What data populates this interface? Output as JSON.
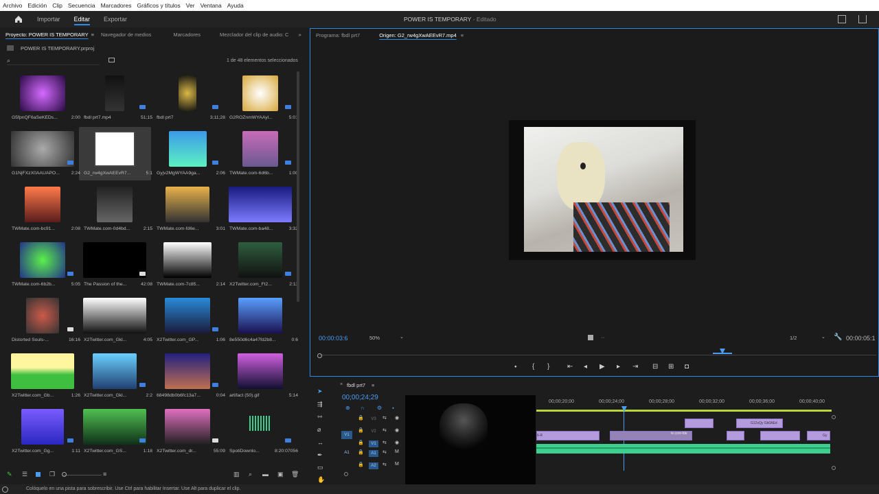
{
  "menu": [
    "Archivo",
    "Edición",
    "Clip",
    "Secuencia",
    "Marcadores",
    "Gráficos y títulos",
    "Ver",
    "Ventana",
    "Ayuda"
  ],
  "workspaces": {
    "import": "Importar",
    "edit": "Editar",
    "export": "Exportar"
  },
  "doc": {
    "title": "POWER IS TEMPORARY",
    "state": "- Editado"
  },
  "project_tabs": [
    "Proyecto: POWER IS TEMPORARY",
    "Navegador de medios",
    "Marcadores",
    "Mezclador del clip de audio: C"
  ],
  "project_file": "POWER IS TEMPORARY.prproj",
  "selection_count": "1 de 48 elementos seleccionados",
  "items": [
    {
      "name": "G5fpnQF6aSeKEDs...",
      "dur": "2:00"
    },
    {
      "name": "fbdl prt7.mp4",
      "dur": "51;15"
    },
    {
      "name": "fbdl prt7",
      "dur": "3;11;28"
    },
    {
      "name": "G2ROZnmWYAAyl...",
      "dur": "5:01"
    },
    {
      "name": "G1NjFXzX0AAUAPO...",
      "dur": "2:24"
    },
    {
      "name": "G2_rw4gXwAEEvR7...",
      "dur": "5:1"
    },
    {
      "name": "Gyjv2MgWYAA9ga...",
      "dur": "2:06"
    },
    {
      "name": "TWMate.com-6d6b...",
      "dur": "1:00"
    },
    {
      "name": "TWMate.com-bc91...",
      "dur": "2:08"
    },
    {
      "name": "TWMate.com-0d4bd...",
      "dur": "2:15"
    },
    {
      "name": "TWMate.com-fd6e...",
      "dur": "3:01"
    },
    {
      "name": "TWMate.com-ba48...",
      "dur": "3:32"
    },
    {
      "name": "TWMate.com-6b2b...",
      "dur": "5:05"
    },
    {
      "name": "The Passion of the...",
      "dur": "42:08"
    },
    {
      "name": "TWMate.com-7c85...",
      "dur": "2:14"
    },
    {
      "name": "X2Twitter.com_Ft2...",
      "dur": "2:11"
    },
    {
      "name": "Distorted Souls-...",
      "dur": "16:16"
    },
    {
      "name": "X2Twitter.com_Gkl...",
      "dur": "4:05"
    },
    {
      "name": "X2Twitter.com_GP...",
      "dur": "1:06"
    },
    {
      "name": "8e550d6c4a47fd2b8...",
      "dur": "0:6"
    },
    {
      "name": "X2Twitter.com_Gb...",
      "dur": "1:26"
    },
    {
      "name": "X2Twitter.com_Gkl...",
      "dur": "2:2"
    },
    {
      "name": "68498db0b6fc13a7...",
      "dur": "0:04"
    },
    {
      "name": "artifact (50).gif",
      "dur": "5:14"
    },
    {
      "name": "X2Twitter.com_Gg...",
      "dur": "1:11"
    },
    {
      "name": "X2Twitter.com_GS...",
      "dur": "1:18"
    },
    {
      "name": "X2Twitter.com_dr...",
      "dur": "55:09"
    },
    {
      "name": "SpotiDownlo...",
      "dur": "8:20:07056"
    }
  ],
  "monitor_tabs": {
    "program": "Programa: fbdl prt7",
    "source": "Origen: G2_rw4gXwAEEvR7.mp4"
  },
  "monitor": {
    "timecode": "00:00:03:6",
    "zoom": "50%",
    "resolution": "1/2",
    "duration": "00:00:05:1"
  },
  "sequence": {
    "name": "fbdl prt7",
    "timecode": "00;00;24;29",
    "ruler": [
      "00;00;20;00",
      "00;00;24;00",
      "00;00;28;00",
      "00;00;32;00",
      "00;00;36;00",
      "00;00;40;00"
    ],
    "tracks": [
      "V3",
      "V2",
      "V1",
      "A1",
      "A2"
    ],
    "src_tracks": [
      "V1",
      "A1"
    ]
  },
  "clips": {
    "c1": "G12xQy Gb0AEd",
    "c2": "te.com-fde",
    "c3": "6-R",
    "c4": "Gy"
  },
  "status": "Colóquelo en una pista para sobrescribir. Use Ctrl para habilitar Insertar. Use Alt para duplicar el clip.",
  "colors": {
    "accent": "#2d8ceb",
    "video_clip": "#b49bdd",
    "audio_clip": "#3ecf8e"
  }
}
